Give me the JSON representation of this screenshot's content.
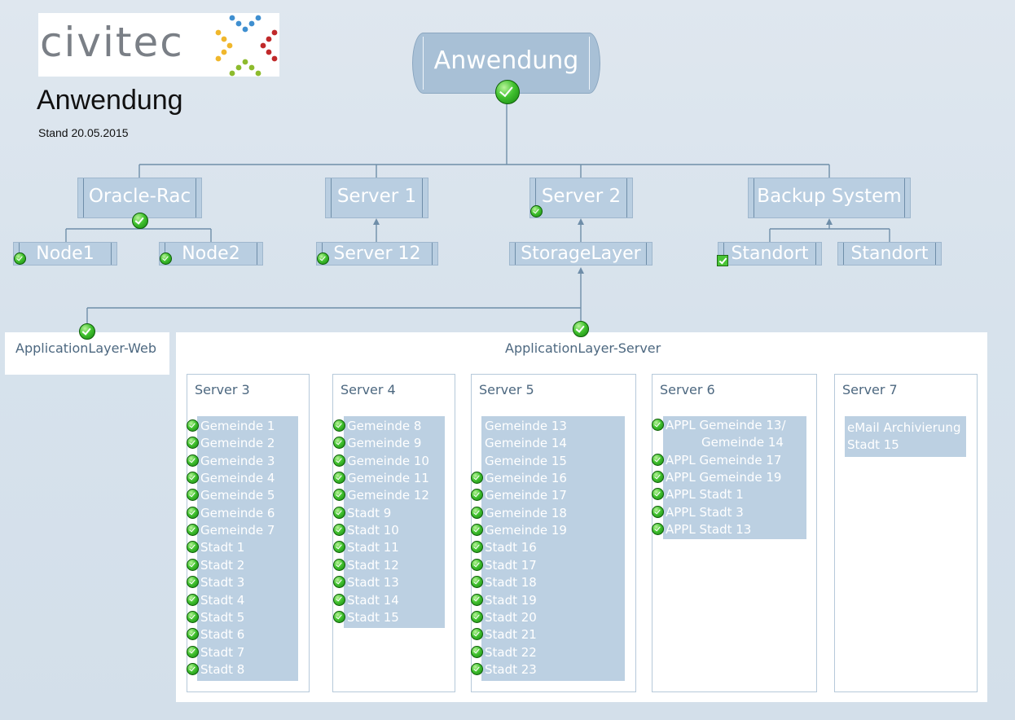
{
  "header": {
    "logo_text": "civitec",
    "title": "Anwendung",
    "stand": "Stand 20.05.2015"
  },
  "colors": {
    "node_fill": "#b9cee1",
    "node_border": "#6f8ea9",
    "list_fill": "#bcd0e2",
    "label_text": "#4d6880",
    "status_ok": "#42c230"
  },
  "top_node": {
    "label": "Anwendung",
    "status": "ok"
  },
  "level1": [
    {
      "label": "Oracle-Rac",
      "status": "ok"
    },
    {
      "label": "Server 1",
      "status": "none"
    },
    {
      "label": "Server 2",
      "status": "ok"
    },
    {
      "label": "Backup System",
      "status": "none"
    }
  ],
  "level2": [
    {
      "label": "Node1",
      "status": "ok"
    },
    {
      "label": "Node2",
      "status": "ok"
    },
    {
      "label": "Server 12",
      "status": "ok"
    },
    {
      "label": "StorageLayer",
      "status": "none"
    },
    {
      "label": "Standort",
      "status": "ok-square"
    },
    {
      "label": "Standort",
      "status": "none"
    }
  ],
  "layers": {
    "web": {
      "label": "ApplicationLayer-Web",
      "status": "ok"
    },
    "server": {
      "label": "ApplicationLayer-Server",
      "status": "ok"
    }
  },
  "servers": [
    {
      "title": "Server 3",
      "items": [
        {
          "label": "Gemeinde 1",
          "ok": true
        },
        {
          "label": "Gemeinde 2",
          "ok": true
        },
        {
          "label": "Gemeinde 3",
          "ok": true
        },
        {
          "label": "Gemeinde 4",
          "ok": true
        },
        {
          "label": "Gemeinde 5",
          "ok": true
        },
        {
          "label": "Gemeinde 6",
          "ok": true
        },
        {
          "label": "Gemeinde 7",
          "ok": true
        },
        {
          "label": "Stadt 1",
          "ok": true
        },
        {
          "label": "Stadt 2",
          "ok": true
        },
        {
          "label": "Stadt 3",
          "ok": true
        },
        {
          "label": "Stadt 4",
          "ok": true
        },
        {
          "label": "Stadt 5",
          "ok": true
        },
        {
          "label": "Stadt 6",
          "ok": true
        },
        {
          "label": "Stadt 7",
          "ok": true
        },
        {
          "label": "Stadt 8",
          "ok": true
        }
      ]
    },
    {
      "title": "Server 4",
      "items": [
        {
          "label": "Gemeinde 8",
          "ok": true
        },
        {
          "label": "Gemeinde 9",
          "ok": true
        },
        {
          "label": "Gemeinde 10",
          "ok": true
        },
        {
          "label": "Gemeinde 11",
          "ok": true
        },
        {
          "label": "Gemeinde 12",
          "ok": true
        },
        {
          "label": "Stadt 9",
          "ok": true
        },
        {
          "label": "Stadt 10",
          "ok": true
        },
        {
          "label": "Stadt 11",
          "ok": true
        },
        {
          "label": "Stadt 12",
          "ok": true
        },
        {
          "label": "Stadt 13",
          "ok": true
        },
        {
          "label": "Stadt 14",
          "ok": true
        },
        {
          "label": "Stadt 15",
          "ok": true
        }
      ]
    },
    {
      "title": "Server 5",
      "items": [
        {
          "label": "Gemeinde 13",
          "ok": false
        },
        {
          "label": "Gemeinde 14",
          "ok": false
        },
        {
          "label": "Gemeinde 15",
          "ok": false
        },
        {
          "label": "Gemeinde 16",
          "ok": true
        },
        {
          "label": "Gemeinde 17",
          "ok": true
        },
        {
          "label": "Gemeinde 18",
          "ok": true
        },
        {
          "label": "Gemeinde 19",
          "ok": true
        },
        {
          "label": "Stadt 16",
          "ok": true
        },
        {
          "label": "Stadt 17",
          "ok": true
        },
        {
          "label": "Stadt 18",
          "ok": true
        },
        {
          "label": "Stadt 19",
          "ok": true
        },
        {
          "label": "Stadt 20",
          "ok": true
        },
        {
          "label": "Stadt 21",
          "ok": true
        },
        {
          "label": "Stadt 22",
          "ok": true
        },
        {
          "label": "Stadt 23",
          "ok": true
        }
      ]
    },
    {
      "title": "Server 6",
      "items": [
        {
          "label": "APPL Gemeinde 13/",
          "ok": true
        },
        {
          "label": "Gemeinde 14",
          "ok": false,
          "indent": true
        },
        {
          "label": "APPL Gemeinde 17",
          "ok": true
        },
        {
          "label": "APPL Gemeinde 19",
          "ok": true
        },
        {
          "label": "APPL Stadt 1",
          "ok": true
        },
        {
          "label": "APPL Stadt 3",
          "ok": true
        },
        {
          "label": "APPL Stadt 13",
          "ok": true
        }
      ]
    },
    {
      "title": "Server 7",
      "items": [
        {
          "label": "eMail Archivierung",
          "ok": false
        },
        {
          "label": "Stadt 15",
          "ok": false
        }
      ]
    }
  ]
}
